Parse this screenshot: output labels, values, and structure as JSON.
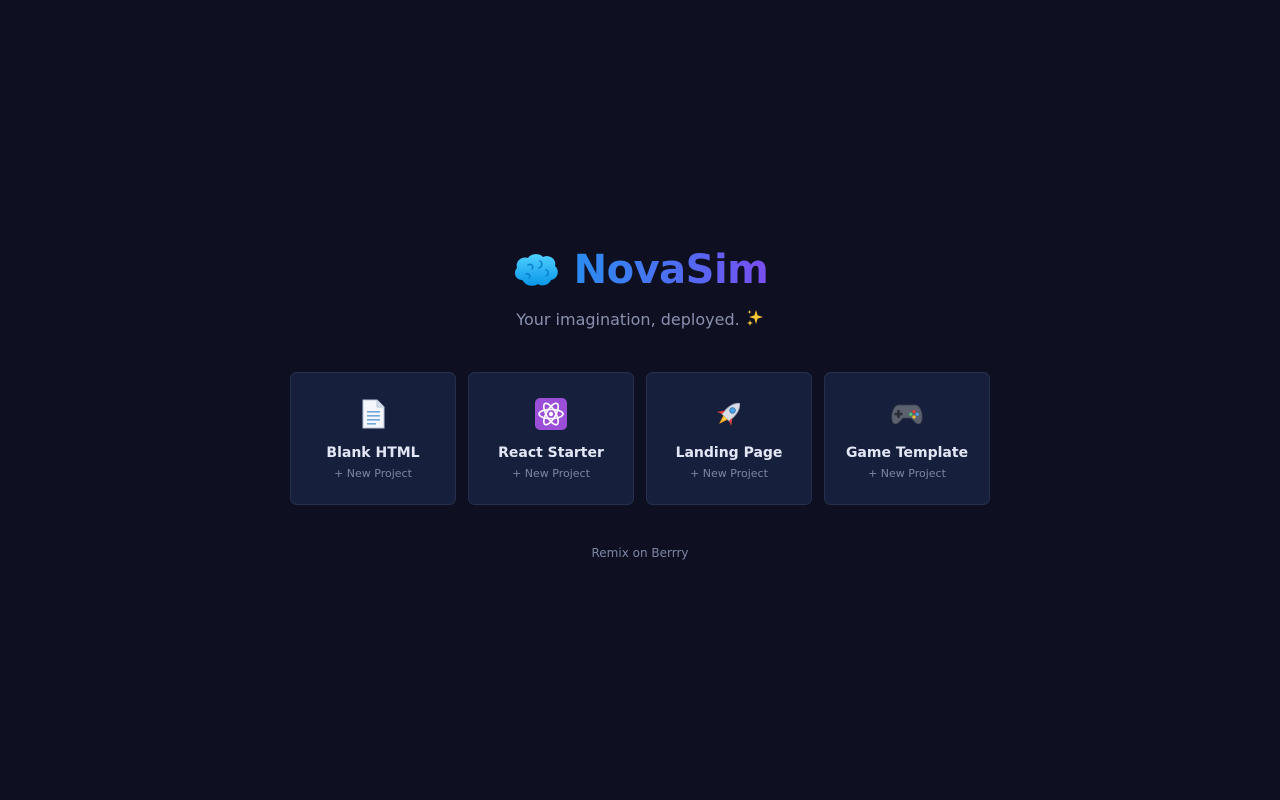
{
  "brand": {
    "title": "NovaSim",
    "icon": "brain-icon"
  },
  "tagline": {
    "text": "Your imagination, deployed.",
    "icon": "sparkles-icon"
  },
  "templates": [
    {
      "title": "Blank HTML",
      "subtitle": "+ New Project",
      "icon": "document-icon"
    },
    {
      "title": "React Starter",
      "subtitle": "+ New Project",
      "icon": "atom-icon"
    },
    {
      "title": "Landing Page",
      "subtitle": "+ New Project",
      "icon": "rocket-icon"
    },
    {
      "title": "Game Template",
      "subtitle": "+ New Project",
      "icon": "gamepad-icon"
    }
  ],
  "footer": {
    "text": "Remix on Berrry"
  },
  "colors": {
    "background": "#0e1022",
    "card_background": "#16203c",
    "card_border": "#26304d",
    "title_gradient_start": "#2b8cf0",
    "title_gradient_end": "#7a4ef0",
    "muted_text": "#8a8fae"
  }
}
